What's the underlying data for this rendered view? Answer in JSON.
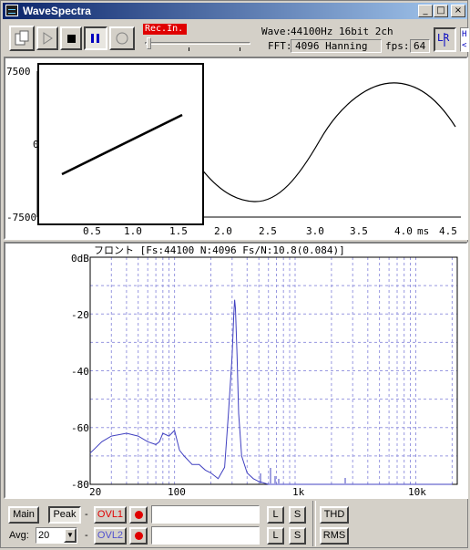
{
  "window": {
    "title": "WaveSpectra"
  },
  "title_buttons": {
    "minimize": "_",
    "maximize": "□",
    "close": "×"
  },
  "toolbar": {
    "rec_indicator": "Rec.In.",
    "wave_label": "Wave:",
    "wave_value": "44100Hz 16bit 2ch",
    "fft_label": "FFT:",
    "fft_value": "4096 Hanning",
    "fps_label": "fps:",
    "fps_value": "64",
    "lr_label": "LR",
    "side_label": "H"
  },
  "waveform": {
    "y_ticks": [
      "7500",
      "0",
      "-7500"
    ],
    "x_ticks": [
      "0.5",
      "1.0",
      "1.5",
      "2.0",
      "2.5",
      "3.0",
      "3.5",
      "4.0",
      "4.5"
    ],
    "x_unit": "ms"
  },
  "spectrum": {
    "header": "フロント  [Fs:44100 N:4096 Fs/N:10.8(0.084)]",
    "y_ticks": [
      "0dB",
      "-20",
      "-40",
      "-60",
      "-80"
    ],
    "x_ticks": [
      "20",
      "100",
      "1k",
      "10k"
    ]
  },
  "chart_data": {
    "type": "line",
    "x_scale": "log",
    "xlim": [
      20,
      22050
    ],
    "ylim": [
      -80,
      0
    ],
    "x_ticks": [
      "20",
      "100",
      "1k",
      "10k"
    ],
    "y_ticks": [
      "0dB",
      "-20",
      "-40",
      "-60",
      "-80"
    ],
    "grid": true,
    "series": [
      {
        "color": "#4040c0",
        "x": [
          20,
          25,
          30,
          40,
          50,
          60,
          70,
          75,
          80,
          90,
          100,
          110,
          120,
          140,
          160,
          180,
          200,
          230,
          260,
          280,
          300,
          310,
          315,
          320,
          330,
          340,
          360,
          400,
          450,
          500,
          600,
          800,
          1000,
          2000,
          5000,
          10000,
          20000
        ],
        "y": [
          -69,
          -65,
          -63,
          -62,
          -63,
          -65,
          -66,
          -65,
          -62,
          -63,
          -61,
          -68,
          -70,
          -73,
          -73,
          -75,
          -76,
          -78,
          -74,
          -55,
          -35,
          -20,
          -15,
          -18,
          -35,
          -55,
          -70,
          -76,
          -78,
          -79,
          -80,
          -80,
          -80,
          -80,
          -80,
          -80,
          -80
        ]
      }
    ]
  },
  "bottom": {
    "main_label": "Main",
    "peak_label": "Peak",
    "dash": "-",
    "ovl1_label": "OVL1",
    "ovl2_label": "OVL2",
    "l_label": "L",
    "s_label": "S",
    "thd_label": "THD",
    "rms_label": "RMS",
    "avg_label": "Avg:",
    "avg_value": "20"
  }
}
